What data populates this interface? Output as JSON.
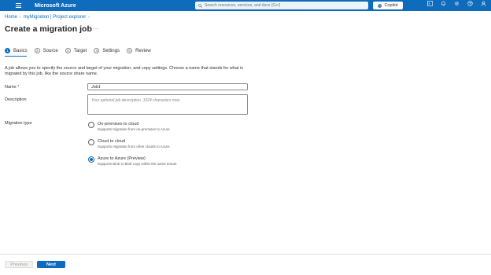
{
  "topbar": {
    "brand": "Microsoft Azure",
    "search_placeholder": "Search resources, services, and docs (G+/)",
    "copilot_label": "Copilot",
    "icons": [
      "terminal-icon",
      "bell-icon",
      "gear-icon",
      "help-icon",
      "feedback-icon"
    ]
  },
  "breadcrumb": {
    "items": [
      "Home",
      "myMigration | Project explorer"
    ]
  },
  "page": {
    "title": "Create a migration job",
    "more_label": "..."
  },
  "steps": [
    {
      "num": "1",
      "label": "Basics",
      "active": true
    },
    {
      "num": "2",
      "label": "Source",
      "active": false
    },
    {
      "num": "3",
      "label": "Target",
      "active": false
    },
    {
      "num": "4",
      "label": "Settings",
      "active": false
    },
    {
      "num": "5",
      "label": "Review",
      "active": false
    }
  ],
  "form": {
    "intro": "A job allows you to specify the source and target of your migration, and copy settings. Choose a name that stands for what is migrated by this job, like the source share name.",
    "name_label": "Name",
    "name_required": " *",
    "name_value": "Job1",
    "description_label": "Description",
    "description_placeholder": "Your optional job description. 1024 characters max.",
    "migration_type_label": "Migration type",
    "options": [
      {
        "title": "On-premises to cloud",
        "subtitle": "Supports migration from on-premises to Azure",
        "selected": false
      },
      {
        "title": "Cloud to cloud",
        "subtitle": "Supports migration from other clouds to Azure",
        "selected": false
      },
      {
        "title": "Azure to Azure (Preview)",
        "subtitle": "Supports Blob to Blob copy within the same tenant",
        "selected": true
      }
    ]
  },
  "footer": {
    "previous_label": "Previous",
    "next_label": "Next"
  },
  "colors": {
    "accent": "#0f6cbd"
  }
}
